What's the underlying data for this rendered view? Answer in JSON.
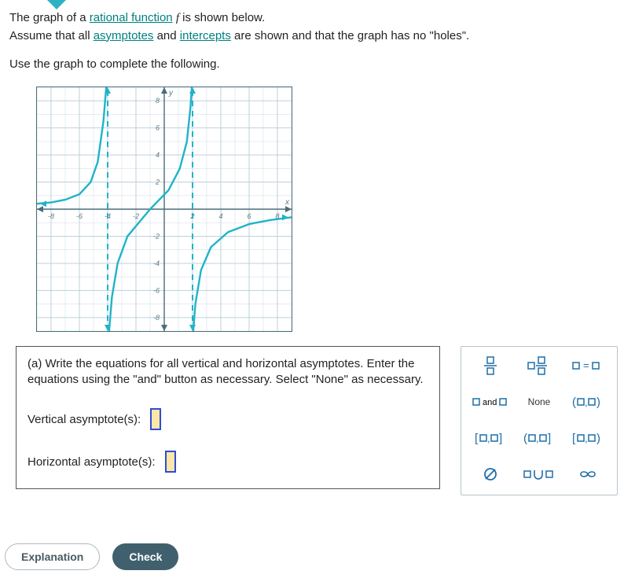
{
  "intro": {
    "part1": "The graph of a ",
    "link1": "rational function",
    "part2": " ",
    "fvar": "f",
    "part3": " is shown below.",
    "line2a": "Assume that all ",
    "link2": "asymptotes",
    "line2b": " and ",
    "link3": "intercepts",
    "line2c": " are shown and that the graph has no \"holes\".",
    "use": "Use the graph to complete the following."
  },
  "question": {
    "label": "(a) Write the equations for all vertical and horizontal asymptotes. Enter the equations using the \"and\" button as necessary. Select \"None\" as necessary.",
    "vertical_label": "Vertical asymptote(s):",
    "horizontal_label": "Horizontal asymptote(s):"
  },
  "palette": {
    "and": "and",
    "none": "None"
  },
  "buttons": {
    "explanation": "Explanation",
    "check": "Check"
  },
  "chart_data": {
    "type": "line",
    "title": "",
    "xlabel": "x",
    "ylabel": "y",
    "xlim": [
      -9,
      9
    ],
    "ylim": [
      -9,
      9
    ],
    "xticks": [
      -8,
      -6,
      -4,
      -2,
      2,
      4,
      6,
      8
    ],
    "yticks": [
      -8,
      -6,
      -4,
      -2,
      2,
      4,
      6,
      8
    ],
    "vertical_asymptotes": [
      -4,
      2
    ],
    "horizontal_asymptotes": [
      0
    ],
    "x_intercepts": [
      -1
    ],
    "series": [
      {
        "name": "left_branch",
        "x": [
          -9,
          -8,
          -7,
          -6,
          -5.2,
          -4.7,
          -4.3,
          -4.1
        ],
        "y": [
          0.4,
          0.5,
          0.7,
          1.1,
          2.0,
          3.5,
          6.5,
          9.0
        ]
      },
      {
        "name": "middle_branch",
        "x": [
          -3.9,
          -3.7,
          -3.3,
          -2.6,
          -1.0,
          0.3,
          1.1,
          1.6,
          1.85,
          1.95
        ],
        "y": [
          -9.0,
          -6.5,
          -4.0,
          -2.0,
          0.0,
          1.4,
          3.0,
          5.0,
          7.5,
          9.0
        ]
      },
      {
        "name": "right_branch",
        "x": [
          2.05,
          2.2,
          2.6,
          3.3,
          4.5,
          6.0,
          7.5,
          9.0
        ],
        "y": [
          -9.0,
          -7.0,
          -4.5,
          -2.8,
          -1.7,
          -1.1,
          -0.8,
          -0.6
        ]
      }
    ]
  }
}
